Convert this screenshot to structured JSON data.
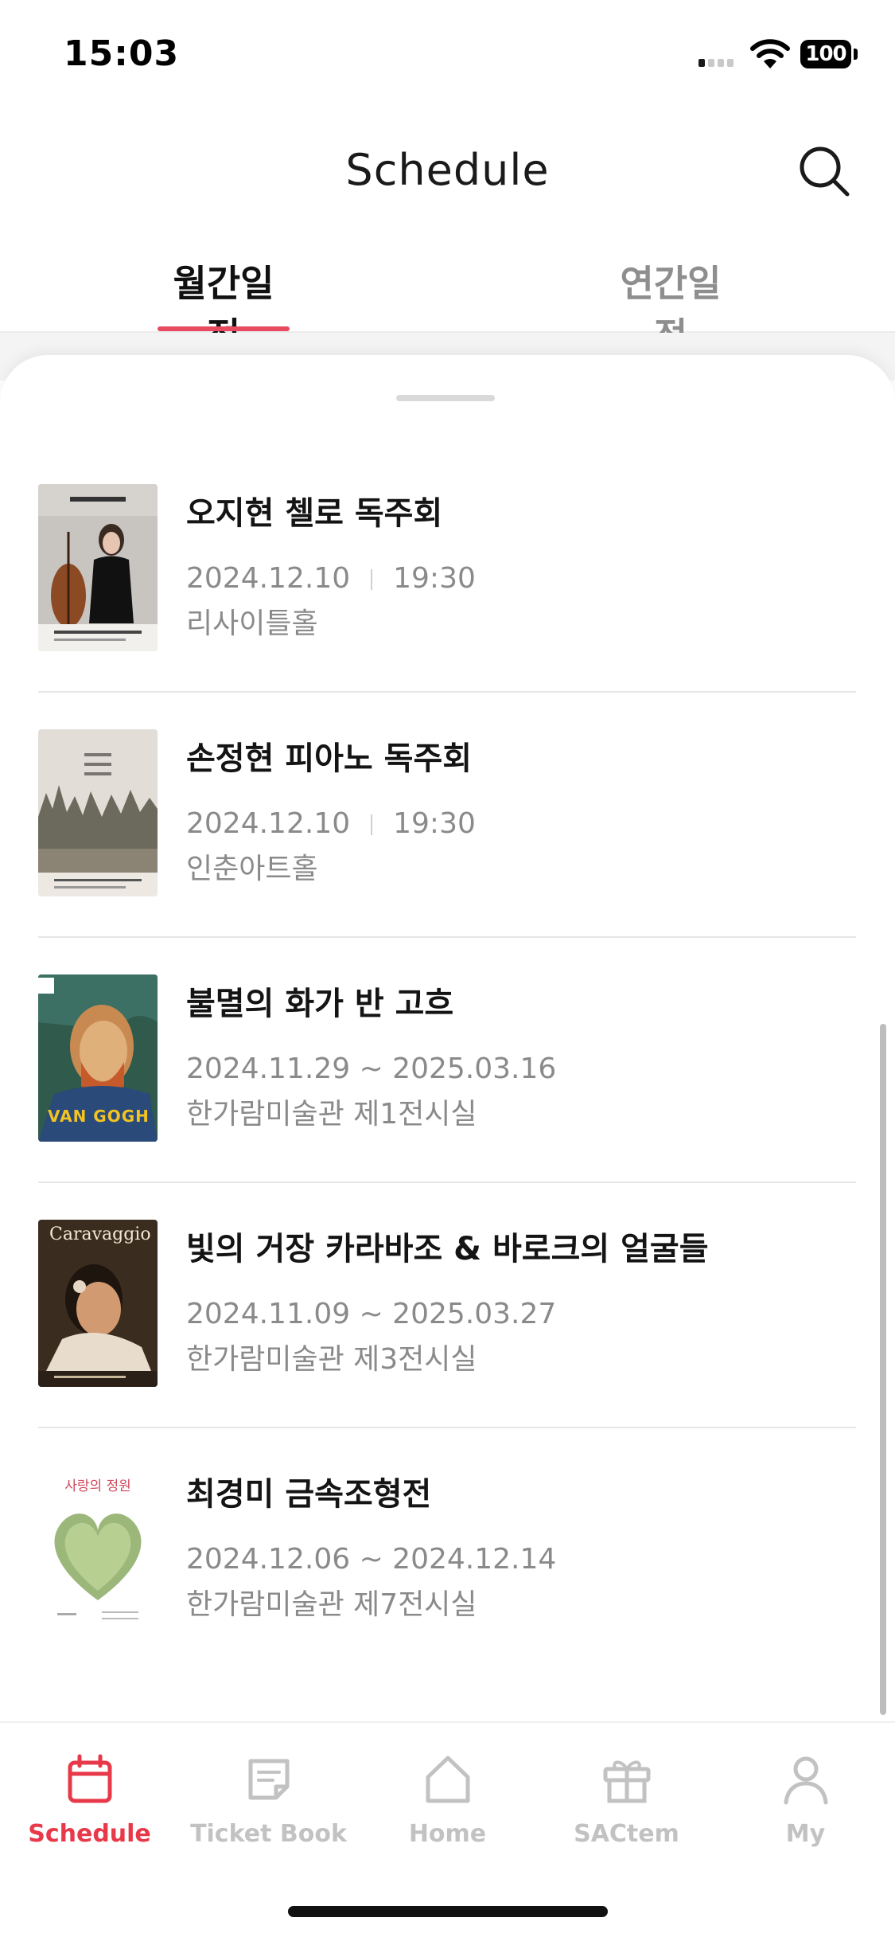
{
  "status_bar": {
    "time": "15:03",
    "battery": "100"
  },
  "header": {
    "title": "Schedule"
  },
  "tabs": [
    {
      "label": "월간일정",
      "active": true
    },
    {
      "label": "연간일정",
      "active": false
    }
  ],
  "items": [
    {
      "title": "오지현 첼로 독주회",
      "date": "2024.12.10",
      "time": "19:30",
      "venue": "리사이틀홀",
      "poster": "cello-recital-poster"
    },
    {
      "title": "손정현 피아노 독주회",
      "date": "2024.12.10",
      "time": "19:30",
      "venue": "인춘아트홀",
      "poster": "piano-recital-poster"
    },
    {
      "title": "불멸의 화가 반 고흐",
      "date": "2024.11.29 ~ 2025.03.16",
      "time": "",
      "venue": "한가람미술관 제1전시실",
      "poster": "van-gogh-poster",
      "poster_text": "VAN GOGH"
    },
    {
      "title": "빛의 거장 카라바조 & 바로크의 얼굴들",
      "date": "2024.11.09 ~ 2025.03.27",
      "time": "",
      "venue": "한가람미술관 제3전시실",
      "poster": "caravaggio-poster",
      "poster_text": "Caravaggio"
    },
    {
      "title": "최경미 금속조형전",
      "date": "2024.12.06 ~ 2024.12.14",
      "time": "",
      "venue": "한가람미술관 제7전시실",
      "poster": "metal-art-poster",
      "poster_text": "사랑의 정원"
    }
  ],
  "bottom_nav": [
    {
      "label": "Schedule",
      "icon": "calendar-icon",
      "active": true
    },
    {
      "label": "Ticket Book",
      "icon": "ticket-book-icon",
      "active": false
    },
    {
      "label": "Home",
      "icon": "home-icon",
      "active": false
    },
    {
      "label": "SACtem",
      "icon": "gift-icon",
      "active": false
    },
    {
      "label": "My",
      "icon": "person-icon",
      "active": false
    }
  ],
  "colors": {
    "accent": "#e8394a",
    "tab_underline": "#e84a5f",
    "secondary_text": "#8a8a8a",
    "nav_inactive": "#c2c2c2"
  }
}
